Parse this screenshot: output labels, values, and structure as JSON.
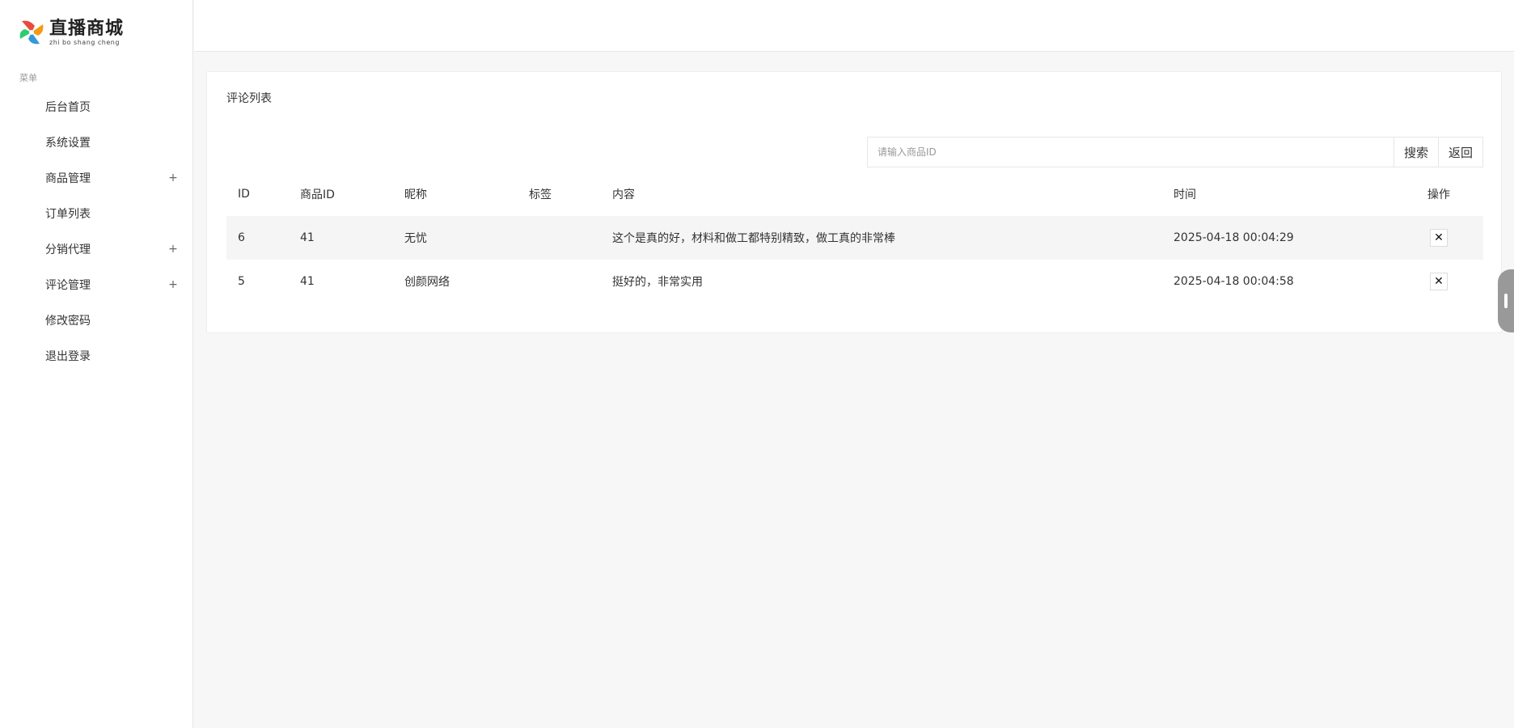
{
  "brand": {
    "title": "直播商城",
    "subtitle": "zhi bo shang cheng"
  },
  "sidebar": {
    "menu_title": "菜单",
    "items": [
      {
        "label": "后台首页",
        "expandable": false
      },
      {
        "label": "系统设置",
        "expandable": false
      },
      {
        "label": "商品管理",
        "expandable": true
      },
      {
        "label": "订单列表",
        "expandable": false
      },
      {
        "label": "分销代理",
        "expandable": true
      },
      {
        "label": "评论管理",
        "expandable": true
      },
      {
        "label": "修改密码",
        "expandable": false
      },
      {
        "label": "退出登录",
        "expandable": false
      }
    ],
    "plus_symbol": "+"
  },
  "main": {
    "card_title": "评论列表",
    "search": {
      "placeholder": "请输入商品ID",
      "value": "",
      "search_label": "搜索",
      "back_label": "返回"
    },
    "table": {
      "headers": [
        "ID",
        "商品ID",
        "昵称",
        "标签",
        "内容",
        "时间",
        "操作"
      ],
      "rows": [
        {
          "id": "6",
          "product_id": "41",
          "nickname": "无忧",
          "tag": "",
          "content": "这个是真的好，材料和做工都特别精致，做工真的非常棒",
          "time": "2025-04-18 00:04:29",
          "action": "✕"
        },
        {
          "id": "5",
          "product_id": "41",
          "nickname": "创颜网络",
          "tag": "",
          "content": "挺好的，非常实用",
          "time": "2025-04-18 00:04:58",
          "action": "✕"
        }
      ]
    }
  },
  "icons": {
    "delete": "close-icon",
    "logo": "pinwheel-logo-icon",
    "side_handle": "drag-handle-icon"
  }
}
